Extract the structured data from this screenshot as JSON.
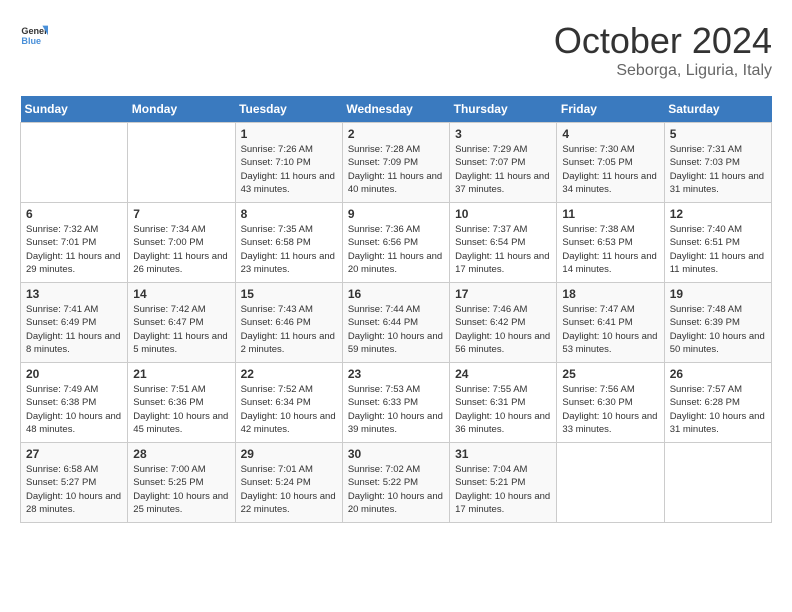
{
  "header": {
    "logo_line1": "General",
    "logo_line2": "Blue",
    "month": "October 2024",
    "location": "Seborga, Liguria, Italy"
  },
  "weekdays": [
    "Sunday",
    "Monday",
    "Tuesday",
    "Wednesday",
    "Thursday",
    "Friday",
    "Saturday"
  ],
  "weeks": [
    [
      {
        "day": "",
        "info": ""
      },
      {
        "day": "",
        "info": ""
      },
      {
        "day": "1",
        "info": "Sunrise: 7:26 AM\nSunset: 7:10 PM\nDaylight: 11 hours and 43 minutes."
      },
      {
        "day": "2",
        "info": "Sunrise: 7:28 AM\nSunset: 7:09 PM\nDaylight: 11 hours and 40 minutes."
      },
      {
        "day": "3",
        "info": "Sunrise: 7:29 AM\nSunset: 7:07 PM\nDaylight: 11 hours and 37 minutes."
      },
      {
        "day": "4",
        "info": "Sunrise: 7:30 AM\nSunset: 7:05 PM\nDaylight: 11 hours and 34 minutes."
      },
      {
        "day": "5",
        "info": "Sunrise: 7:31 AM\nSunset: 7:03 PM\nDaylight: 11 hours and 31 minutes."
      }
    ],
    [
      {
        "day": "6",
        "info": "Sunrise: 7:32 AM\nSunset: 7:01 PM\nDaylight: 11 hours and 29 minutes."
      },
      {
        "day": "7",
        "info": "Sunrise: 7:34 AM\nSunset: 7:00 PM\nDaylight: 11 hours and 26 minutes."
      },
      {
        "day": "8",
        "info": "Sunrise: 7:35 AM\nSunset: 6:58 PM\nDaylight: 11 hours and 23 minutes."
      },
      {
        "day": "9",
        "info": "Sunrise: 7:36 AM\nSunset: 6:56 PM\nDaylight: 11 hours and 20 minutes."
      },
      {
        "day": "10",
        "info": "Sunrise: 7:37 AM\nSunset: 6:54 PM\nDaylight: 11 hours and 17 minutes."
      },
      {
        "day": "11",
        "info": "Sunrise: 7:38 AM\nSunset: 6:53 PM\nDaylight: 11 hours and 14 minutes."
      },
      {
        "day": "12",
        "info": "Sunrise: 7:40 AM\nSunset: 6:51 PM\nDaylight: 11 hours and 11 minutes."
      }
    ],
    [
      {
        "day": "13",
        "info": "Sunrise: 7:41 AM\nSunset: 6:49 PM\nDaylight: 11 hours and 8 minutes."
      },
      {
        "day": "14",
        "info": "Sunrise: 7:42 AM\nSunset: 6:47 PM\nDaylight: 11 hours and 5 minutes."
      },
      {
        "day": "15",
        "info": "Sunrise: 7:43 AM\nSunset: 6:46 PM\nDaylight: 11 hours and 2 minutes."
      },
      {
        "day": "16",
        "info": "Sunrise: 7:44 AM\nSunset: 6:44 PM\nDaylight: 10 hours and 59 minutes."
      },
      {
        "day": "17",
        "info": "Sunrise: 7:46 AM\nSunset: 6:42 PM\nDaylight: 10 hours and 56 minutes."
      },
      {
        "day": "18",
        "info": "Sunrise: 7:47 AM\nSunset: 6:41 PM\nDaylight: 10 hours and 53 minutes."
      },
      {
        "day": "19",
        "info": "Sunrise: 7:48 AM\nSunset: 6:39 PM\nDaylight: 10 hours and 50 minutes."
      }
    ],
    [
      {
        "day": "20",
        "info": "Sunrise: 7:49 AM\nSunset: 6:38 PM\nDaylight: 10 hours and 48 minutes."
      },
      {
        "day": "21",
        "info": "Sunrise: 7:51 AM\nSunset: 6:36 PM\nDaylight: 10 hours and 45 minutes."
      },
      {
        "day": "22",
        "info": "Sunrise: 7:52 AM\nSunset: 6:34 PM\nDaylight: 10 hours and 42 minutes."
      },
      {
        "day": "23",
        "info": "Sunrise: 7:53 AM\nSunset: 6:33 PM\nDaylight: 10 hours and 39 minutes."
      },
      {
        "day": "24",
        "info": "Sunrise: 7:55 AM\nSunset: 6:31 PM\nDaylight: 10 hours and 36 minutes."
      },
      {
        "day": "25",
        "info": "Sunrise: 7:56 AM\nSunset: 6:30 PM\nDaylight: 10 hours and 33 minutes."
      },
      {
        "day": "26",
        "info": "Sunrise: 7:57 AM\nSunset: 6:28 PM\nDaylight: 10 hours and 31 minutes."
      }
    ],
    [
      {
        "day": "27",
        "info": "Sunrise: 6:58 AM\nSunset: 5:27 PM\nDaylight: 10 hours and 28 minutes."
      },
      {
        "day": "28",
        "info": "Sunrise: 7:00 AM\nSunset: 5:25 PM\nDaylight: 10 hours and 25 minutes."
      },
      {
        "day": "29",
        "info": "Sunrise: 7:01 AM\nSunset: 5:24 PM\nDaylight: 10 hours and 22 minutes."
      },
      {
        "day": "30",
        "info": "Sunrise: 7:02 AM\nSunset: 5:22 PM\nDaylight: 10 hours and 20 minutes."
      },
      {
        "day": "31",
        "info": "Sunrise: 7:04 AM\nSunset: 5:21 PM\nDaylight: 10 hours and 17 minutes."
      },
      {
        "day": "",
        "info": ""
      },
      {
        "day": "",
        "info": ""
      }
    ]
  ]
}
